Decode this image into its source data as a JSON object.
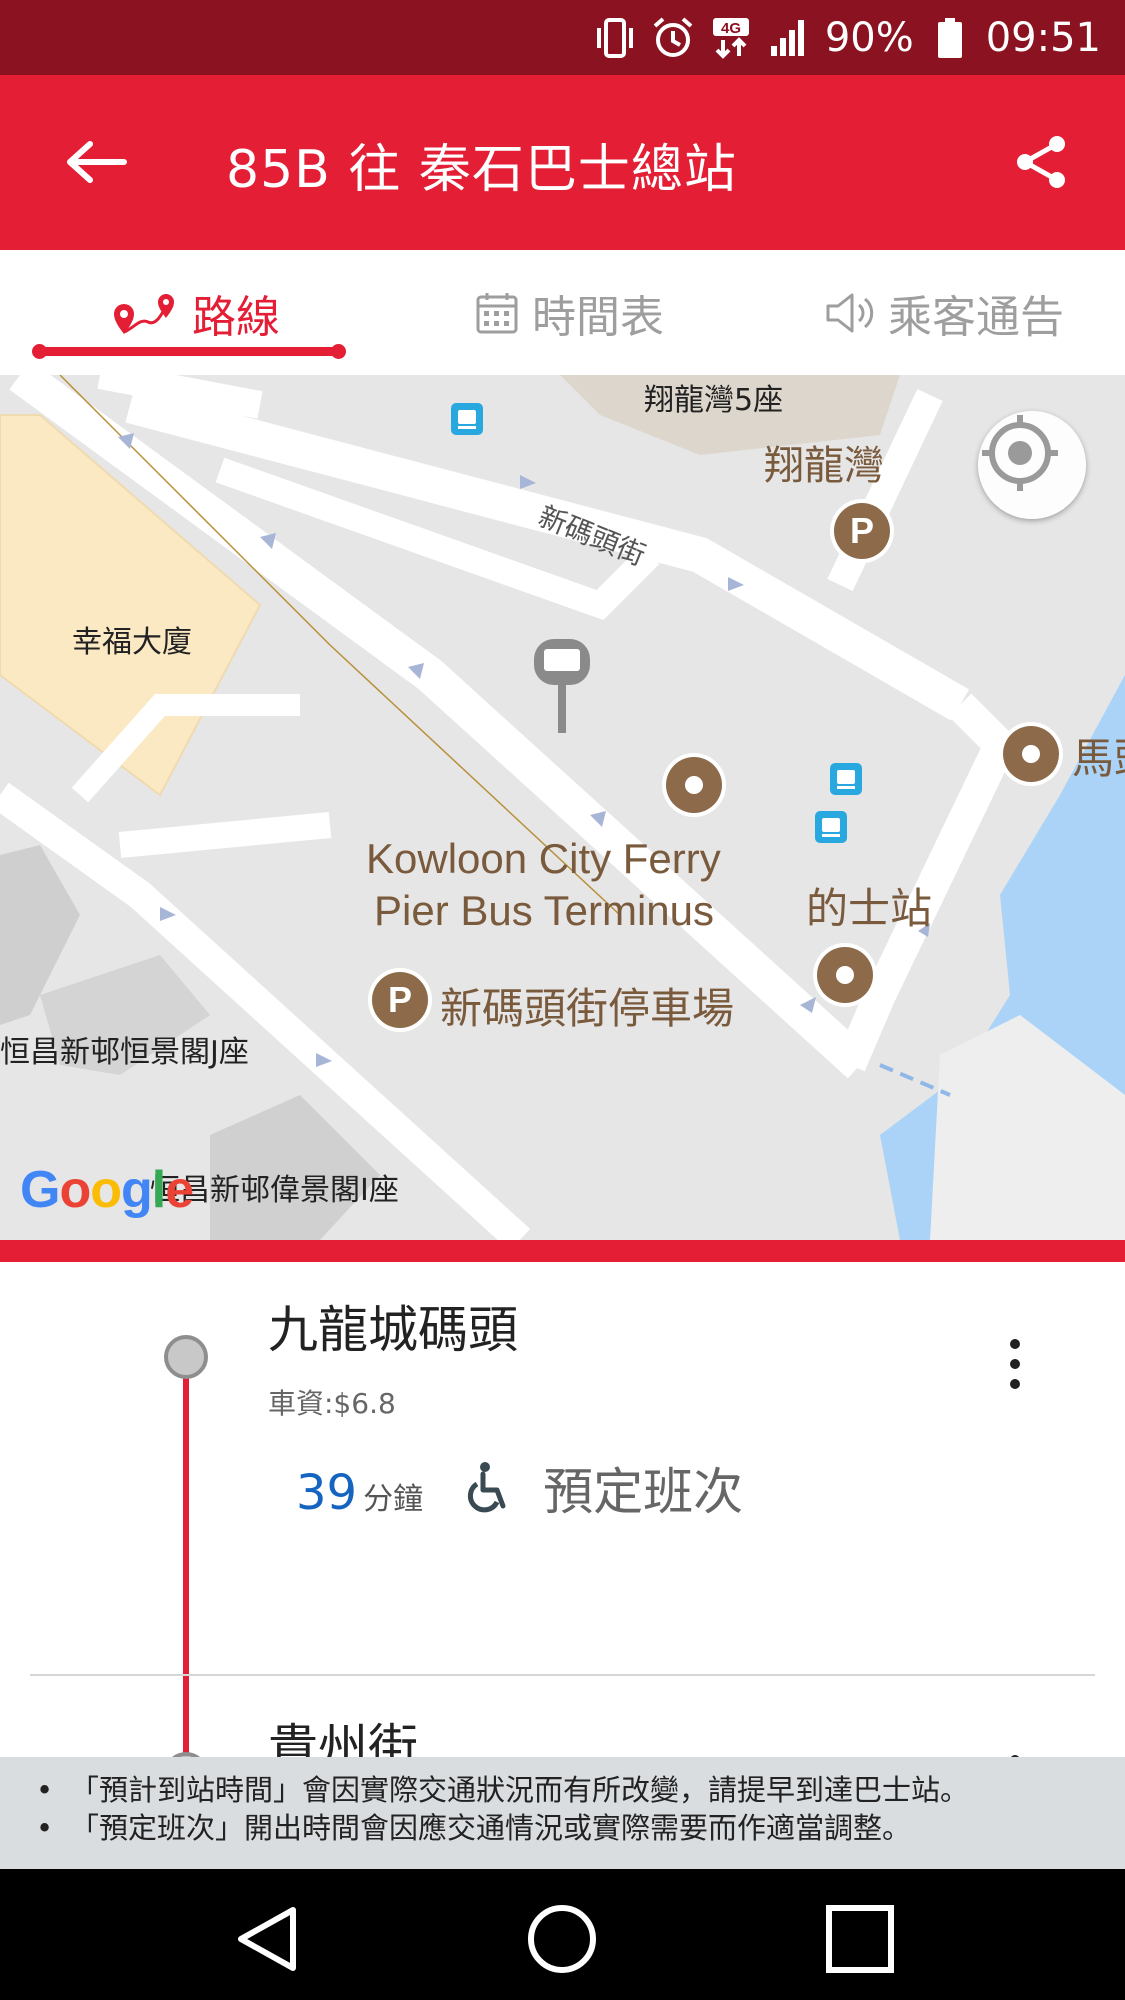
{
  "status_bar": {
    "battery": "90%",
    "time": "09:51",
    "network": "4G",
    "icons": [
      "vibrate-icon",
      "alarm-icon",
      "network-4g-icon",
      "signal-icon",
      "battery-icon"
    ]
  },
  "app_bar": {
    "title": "85B 往 秦石巴士總站",
    "back_icon": "arrow-left-icon",
    "share_icon": "share-icon"
  },
  "tabs": [
    {
      "label": "路線",
      "icon": "route-pin-icon",
      "active": true
    },
    {
      "label": "時間表",
      "icon": "calendar-icon",
      "active": false
    },
    {
      "label": "乘客通告",
      "icon": "speaker-icon",
      "active": false
    }
  ],
  "map": {
    "labels": {
      "building_5": "翔龍灣5座",
      "estate": "翔龍灣",
      "street": "新碼頭街",
      "happy_building": "幸福大廈",
      "terminus_line1": "Kowloon City Ferry",
      "terminus_line2": "Pier Bus Terminus",
      "taxi_stand": "的士站",
      "car_park": "新碼頭街停車場",
      "block_j": "恒昌新邨恒景閣J座",
      "block_i": "恒昌新邨偉景閣I座",
      "edge_label": "馬頭"
    },
    "parking_symbol": "P",
    "google_logo": "Google",
    "colors": {
      "road": "#ffffff",
      "ground": "#e6e6e6",
      "building": "#fbe9c4",
      "water": "#aad3f7",
      "poi": "#8d6a4a"
    }
  },
  "stops": [
    {
      "name": "九龍城碼頭",
      "fare": "車資:$6.8",
      "eta_minutes": "39",
      "eta_unit": "分鐘",
      "scheduled": "預定班次"
    },
    {
      "name": "貴州街"
    }
  ],
  "notices": [
    "「預計到站時間」會因實際交通狀況而有所改變，請提早到達巴士站。",
    "「預定班次」開出時間會因應交通情況或實際需要而作適當調整。"
  ],
  "notice_bullet": "•",
  "colors": {
    "primary": "#e31e35",
    "status": "#8b1220",
    "eta": "#1565c0"
  }
}
